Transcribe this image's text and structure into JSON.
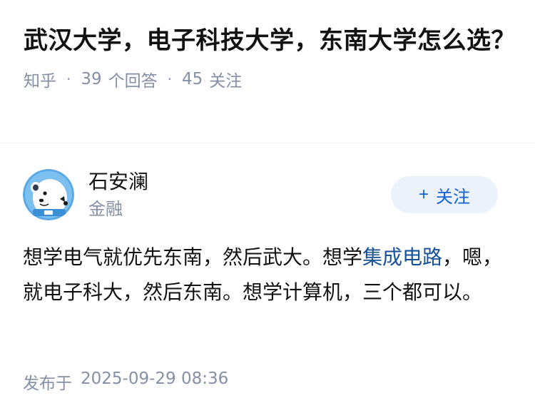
{
  "question": {
    "title": "武汉大学，电子科技大学，东南大学怎么选？",
    "source": "知乎",
    "answer_count": "39",
    "answer_label": "个回答",
    "follow_count": "45",
    "follow_label": "关注"
  },
  "author": {
    "name": "石安澜",
    "tag": "金融",
    "avatar_icon": "polar-bear-avatar-icon",
    "follow_button": {
      "plus": "+",
      "label": "关注"
    }
  },
  "answer": {
    "text_1": "想学电气就优先东南，然后武大。想学",
    "link_text": "集成电路",
    "text_2": "，嗯，就电子科大，然后东南。想学计算机，三个都可以。"
  },
  "publish": {
    "label": "发布于",
    "date": "2025-09-29 08:36"
  },
  "colors": {
    "meta_gray": "#8590a6",
    "link_blue": "#175199",
    "follow_button_bg": "#ebf2fb",
    "follow_button_text": "#0f62d6"
  }
}
